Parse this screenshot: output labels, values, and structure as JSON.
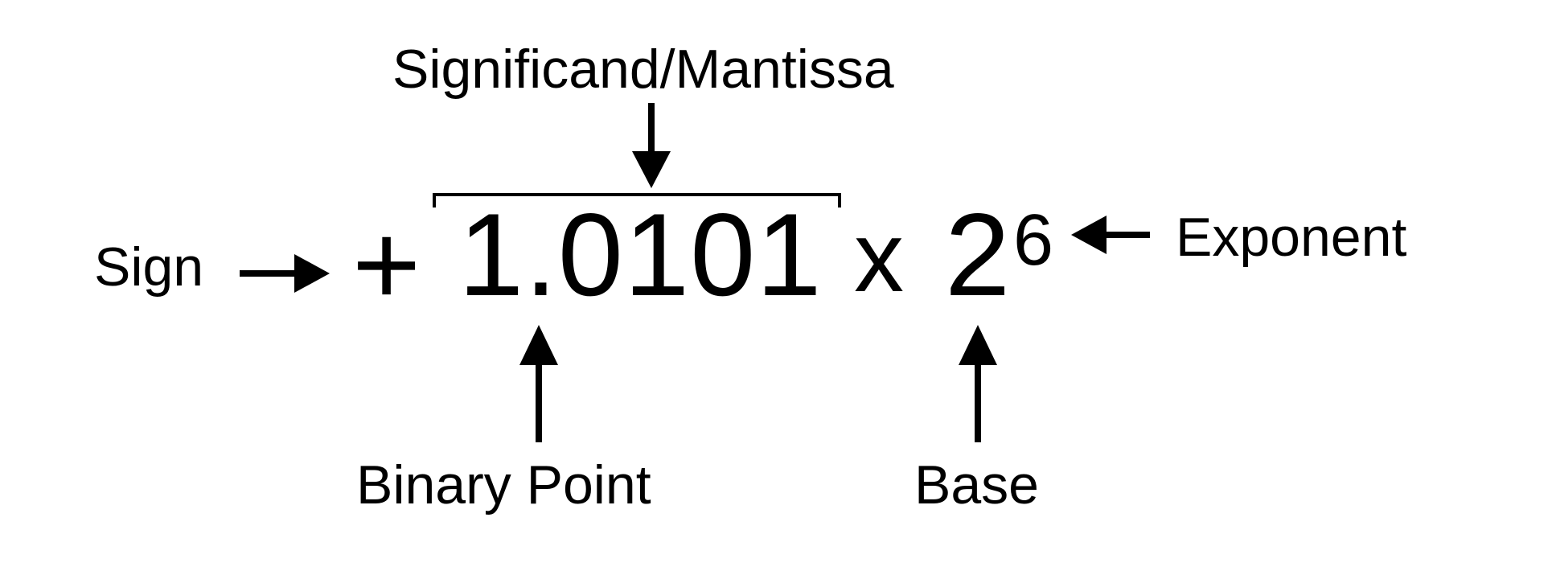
{
  "labels": {
    "significand": "Significand/Mantissa",
    "sign": "Sign",
    "exponent": "Exponent",
    "binary_point": "Binary Point",
    "base": "Base"
  },
  "expression": {
    "sign": "+",
    "significand": "1.0101",
    "times": "x",
    "base": "2",
    "exponent": "6"
  },
  "colors": {
    "ink": "#000000",
    "background": "#ffffff"
  }
}
